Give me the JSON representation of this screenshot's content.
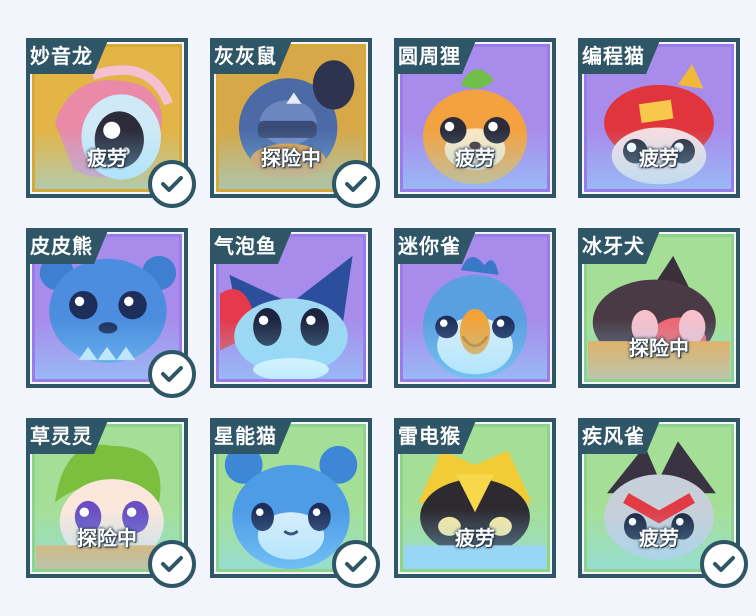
{
  "cards": [
    {
      "name": "妙音龙",
      "status": "疲劳",
      "checked": true
    },
    {
      "name": "灰灰鼠",
      "status": "探险中",
      "checked": true
    },
    {
      "name": "圆周狸",
      "status": "疲劳",
      "checked": false
    },
    {
      "name": "编程猫",
      "status": "疲劳",
      "checked": false
    },
    {
      "name": "皮皮熊",
      "status": "",
      "checked": true
    },
    {
      "name": "气泡鱼",
      "status": "",
      "checked": false
    },
    {
      "name": "迷你雀",
      "status": "",
      "checked": false
    },
    {
      "name": "冰牙犬",
      "status": "探险中",
      "checked": false
    },
    {
      "name": "草灵灵",
      "status": "探险中",
      "checked": true
    },
    {
      "name": "星能猫",
      "status": "",
      "checked": true
    },
    {
      "name": "雷电猴",
      "status": "疲劳",
      "checked": false
    },
    {
      "name": "疾风雀",
      "status": "疲劳",
      "checked": true
    }
  ],
  "colors": {
    "border": "#2f5666",
    "check": "#2f5666",
    "frame_gold": "#d4a93a",
    "frame_purple": "#9a7ce8",
    "frame_green": "#8fd38a"
  },
  "icons": {
    "check": "check-icon"
  }
}
